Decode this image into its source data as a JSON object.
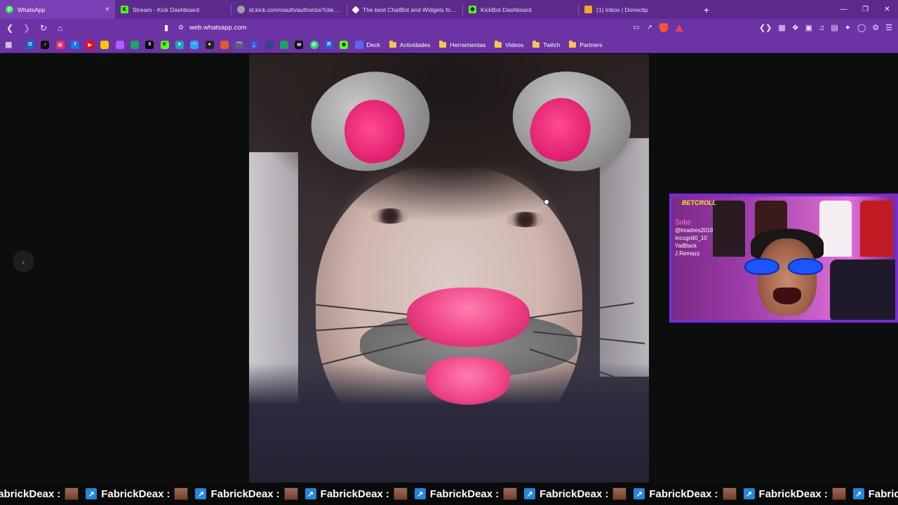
{
  "browser": {
    "tabs": [
      {
        "title": "WhatsApp",
        "active": true,
        "favicon_color": "#25d366"
      },
      {
        "title": "Stream - Kick Dashboard",
        "active": false,
        "favicon_color": "#53fc18"
      },
      {
        "title": "id.kick.com/oauth/authorize?client_id",
        "active": false,
        "favicon_color": "#9aa0a6"
      },
      {
        "title": "The best ChatBot and Widgets for Kic",
        "active": false,
        "favicon_color": "#ffffff"
      },
      {
        "title": "KickBot Dashboard",
        "active": false,
        "favicon_color": "#53fc18"
      },
      {
        "title": "(1) Inbox | Donoclip",
        "active": false,
        "favicon_color": "#f5a623"
      }
    ],
    "close_tab": "×",
    "new_tab": "+",
    "url": "web.whatsapp.com",
    "bookmark_folders": [
      "Deck",
      "Actividades",
      "Herramientas",
      "Videos",
      "Twitch",
      "Partners"
    ],
    "bookmark_icons": [
      {
        "icon": "outlook-icon",
        "color": "#0f6cbd"
      },
      {
        "icon": "tiktok-icon",
        "color": "#111111"
      },
      {
        "icon": "instagram-icon",
        "color": "#e1306c"
      },
      {
        "icon": "facebook-icon",
        "color": "#1877f2"
      },
      {
        "icon": "youtube-icon",
        "color": "#ff0000"
      },
      {
        "icon": "keep-icon",
        "color": "#f7c600"
      },
      {
        "icon": "analytics-icon",
        "color": "#b05cff"
      },
      {
        "icon": "drive-icon",
        "color": "#1fa463"
      },
      {
        "icon": "x-icon",
        "color": "#000000"
      },
      {
        "icon": "kick-icon",
        "color": "#53fc18"
      },
      {
        "icon": "edge-icon",
        "color": "#1ea1b8"
      },
      {
        "icon": "tool-icon",
        "color": "#2aa8ff"
      },
      {
        "icon": "obs-icon",
        "color": "#222222"
      },
      {
        "icon": "photo-icon",
        "color": "#e05a2a"
      },
      {
        "icon": "arc-icon",
        "color": "#5b5b8a"
      },
      {
        "icon": "anchor-icon",
        "color": "#3a4bd0"
      },
      {
        "icon": "game-icon",
        "color": "#3a3f8a"
      },
      {
        "icon": "chat-icon",
        "color": "#21a35a"
      },
      {
        "icon": "mail-icon",
        "color": "#111111"
      },
      {
        "icon": "whatsapp-icon",
        "color": "#25d366"
      },
      {
        "icon": "r-icon",
        "color": "#2f5be0"
      },
      {
        "icon": "kick-alt-icon",
        "color": "#53fc18"
      },
      {
        "icon": "deck-icon",
        "color": "#5865f2"
      }
    ],
    "window_controls": [
      "—",
      "❐",
      "✕"
    ]
  },
  "viewer": {
    "prev_label": "‹"
  },
  "webcam": {
    "logo_text": "BETCROLL",
    "overlay_lines": [
      "Subs",
      "@lmadres2018",
      "Incognit0_10",
      "YatBlack",
      "J.Remazz"
    ]
  },
  "ticker": {
    "name": "FabrickDeax",
    "separator": ":",
    "badge": "↗"
  },
  "colors": {
    "tabstrip": "#5b2a8c",
    "toolbar": "#6b33a3",
    "webcam_border": "#7a2bd8"
  }
}
